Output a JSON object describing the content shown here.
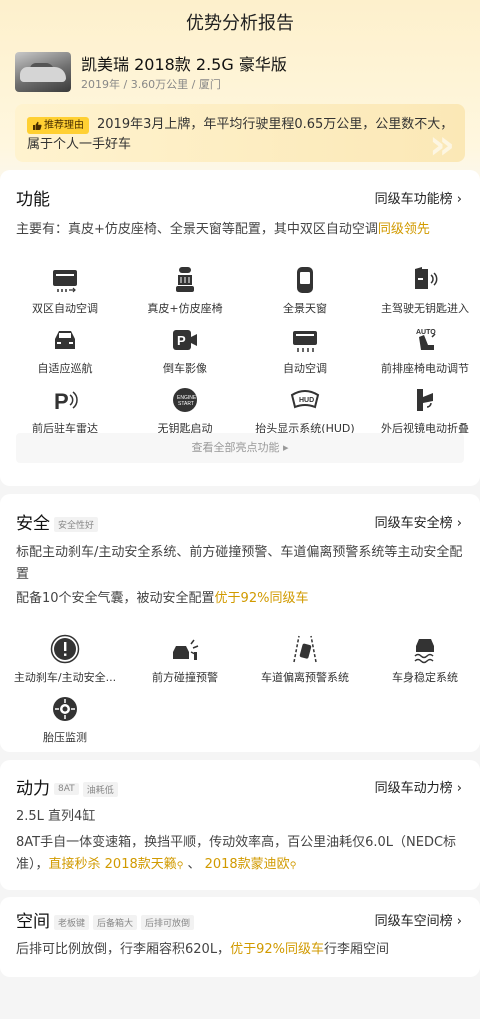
{
  "page": {
    "title": "优势分析报告"
  },
  "car": {
    "name": "凯美瑞 2018款 2.5G 豪华版",
    "meta": "2019年 / 3.60万公里 / 厦门"
  },
  "reason": {
    "tag": "推荐理由",
    "text": "2019年3月上牌，年平均行驶里程0.65万公里，公里数不大，属于个人一手好车"
  },
  "features": {
    "title": "功能",
    "link": "同级车功能榜",
    "desc_prefix": "主要有：真皮+仿皮座椅、全景天窗等配置，其中双区自动空调",
    "desc_highlight": "同级领先",
    "items": [
      {
        "icon": "dual-zone-ac-icon",
        "label": "双区自动空调"
      },
      {
        "icon": "leather-seat-icon",
        "label": "真皮+仿皮座椅"
      },
      {
        "icon": "panoramic-sunroof-icon",
        "label": "全景天窗"
      },
      {
        "icon": "keyless-entry-icon",
        "label": "主驾驶无钥匙进入"
      },
      {
        "icon": "adaptive-cruise-icon",
        "label": "自适应巡航"
      },
      {
        "icon": "reverse-camera-icon",
        "label": "倒车影像"
      },
      {
        "icon": "auto-ac-icon",
        "label": "自动空调"
      },
      {
        "icon": "power-seat-icon",
        "label": "前排座椅电动调节"
      },
      {
        "icon": "parking-radar-icon",
        "label": "前后驻车雷达"
      },
      {
        "icon": "push-start-icon",
        "label": "无钥匙启动"
      },
      {
        "icon": "hud-icon",
        "label": "抬头显示系统(HUD)"
      },
      {
        "icon": "folding-mirror-icon",
        "label": "外后视镜电动折叠"
      }
    ],
    "more": "查看全部亮点功能 ▸"
  },
  "safety": {
    "title": "安全",
    "tag": "安全性好",
    "link": "同级车安全榜",
    "desc1": "标配主动刹车/主动安全系统、前方碰撞预警、车道偏离预警系统等主动安全配置",
    "desc2_prefix": "配备10个安全气囊，被动安全配置",
    "desc2_highlight": "优于92%同级车",
    "items": [
      {
        "icon": "active-brake-icon",
        "label": "主动刹车/主动安全..."
      },
      {
        "icon": "collision-warning-icon",
        "label": "前方碰撞预警"
      },
      {
        "icon": "lane-departure-icon",
        "label": "车道偏离预警系统"
      },
      {
        "icon": "stability-control-icon",
        "label": "车身稳定系统"
      },
      {
        "icon": "tire-pressure-icon",
        "label": "胎压监测"
      }
    ]
  },
  "power": {
    "title": "动力",
    "tags": [
      "8AT",
      "油耗低"
    ],
    "link": "同级车动力榜",
    "engine": "2.5L 直列4缸",
    "desc_prefix": "8AT手自一体变速箱，换挡平顺，传动效率高，百公里油耗仅6.0L（NEDC标准），",
    "desc_highlight1": "直接秒杀 2018款天籁",
    "desc_sep": " 、 ",
    "desc_highlight2": "2018款蒙迪欧"
  },
  "space": {
    "title": "空间",
    "tags": [
      "老板键",
      "后备箱大",
      "后排可放倒"
    ],
    "link": "同级车空间榜",
    "desc_prefix": "后排可比例放倒，行李厢容积620L，",
    "desc_highlight": "优于92%同级车",
    "desc_suffix": "行李厢空间"
  },
  "colors": {
    "accent": "#d19a00",
    "tag_yellow": "#ffd033",
    "hero_bg": "#fdf0cc"
  }
}
